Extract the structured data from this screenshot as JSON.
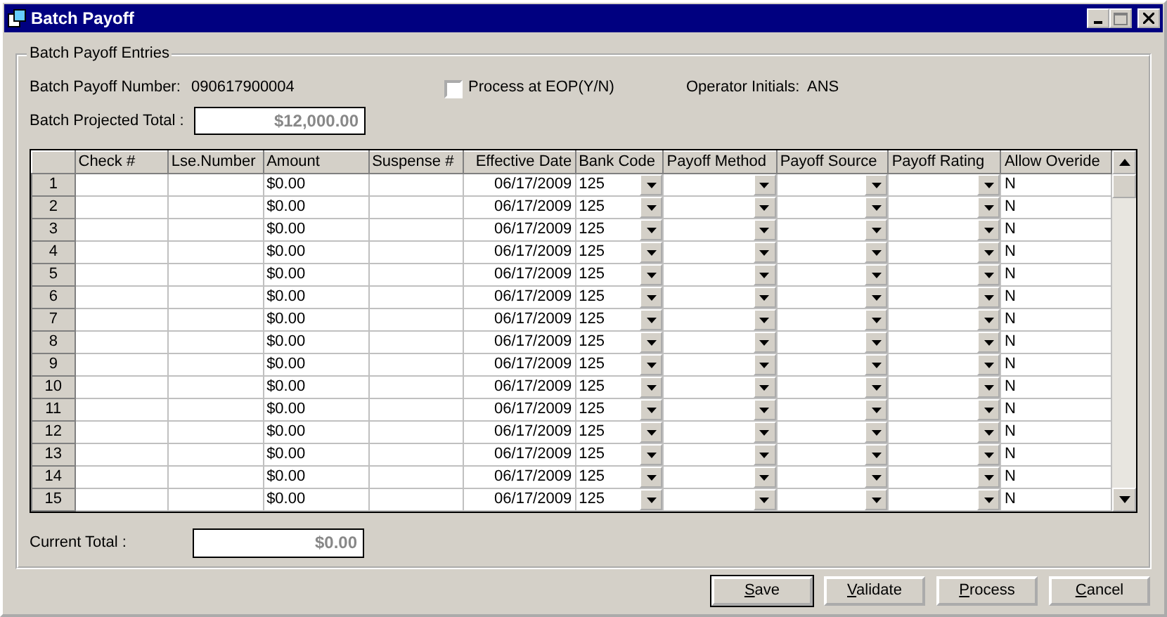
{
  "window": {
    "title": "Batch Payoff"
  },
  "group": {
    "title": "Batch Payoff Entries"
  },
  "batch_number": {
    "label": "Batch Payoff Number:",
    "value": "090617900004"
  },
  "process_eop": {
    "label": "Process at EOP(Y/N)",
    "checked": false
  },
  "operator": {
    "label": "Operator Initials:",
    "value": "ANS"
  },
  "projected_total": {
    "label": "Batch Projected Total :",
    "value": "$12,000.00"
  },
  "table": {
    "columns": [
      {
        "label": "Check #",
        "kind": "text"
      },
      {
        "label": "Lse.Number",
        "kind": "text"
      },
      {
        "label": "Amount",
        "kind": "text"
      },
      {
        "label": "Suspense #",
        "kind": "text"
      },
      {
        "label": "Effective Date",
        "kind": "date"
      },
      {
        "label": "Bank Code",
        "kind": "combo"
      },
      {
        "label": "Payoff Method",
        "kind": "combo"
      },
      {
        "label": "Payoff Source",
        "kind": "combo"
      },
      {
        "label": "Payoff Rating",
        "kind": "combo"
      },
      {
        "label": "Allow Overide",
        "kind": "text"
      }
    ],
    "rows": [
      {
        "number": "1",
        "cells": [
          "",
          "",
          "$0.00",
          "",
          "06/17/2009",
          "125",
          "",
          "",
          "",
          "N"
        ]
      },
      {
        "number": "2",
        "cells": [
          "",
          "",
          "$0.00",
          "",
          "06/17/2009",
          "125",
          "",
          "",
          "",
          "N"
        ]
      },
      {
        "number": "3",
        "cells": [
          "",
          "",
          "$0.00",
          "",
          "06/17/2009",
          "125",
          "",
          "",
          "",
          "N"
        ]
      },
      {
        "number": "4",
        "cells": [
          "",
          "",
          "$0.00",
          "",
          "06/17/2009",
          "125",
          "",
          "",
          "",
          "N"
        ]
      },
      {
        "number": "5",
        "cells": [
          "",
          "",
          "$0.00",
          "",
          "06/17/2009",
          "125",
          "",
          "",
          "",
          "N"
        ]
      },
      {
        "number": "6",
        "cells": [
          "",
          "",
          "$0.00",
          "",
          "06/17/2009",
          "125",
          "",
          "",
          "",
          "N"
        ]
      },
      {
        "number": "7",
        "cells": [
          "",
          "",
          "$0.00",
          "",
          "06/17/2009",
          "125",
          "",
          "",
          "",
          "N"
        ]
      },
      {
        "number": "8",
        "cells": [
          "",
          "",
          "$0.00",
          "",
          "06/17/2009",
          "125",
          "",
          "",
          "",
          "N"
        ]
      },
      {
        "number": "9",
        "cells": [
          "",
          "",
          "$0.00",
          "",
          "06/17/2009",
          "125",
          "",
          "",
          "",
          "N"
        ]
      },
      {
        "number": "10",
        "cells": [
          "",
          "",
          "$0.00",
          "",
          "06/17/2009",
          "125",
          "",
          "",
          "",
          "N"
        ]
      },
      {
        "number": "11",
        "cells": [
          "",
          "",
          "$0.00",
          "",
          "06/17/2009",
          "125",
          "",
          "",
          "",
          "N"
        ]
      },
      {
        "number": "12",
        "cells": [
          "",
          "",
          "$0.00",
          "",
          "06/17/2009",
          "125",
          "",
          "",
          "",
          "N"
        ]
      },
      {
        "number": "13",
        "cells": [
          "",
          "",
          "$0.00",
          "",
          "06/17/2009",
          "125",
          "",
          "",
          "",
          "N"
        ]
      },
      {
        "number": "14",
        "cells": [
          "",
          "",
          "$0.00",
          "",
          "06/17/2009",
          "125",
          "",
          "",
          "",
          "N"
        ]
      },
      {
        "number": "15",
        "cells": [
          "",
          "",
          "$0.00",
          "",
          "06/17/2009",
          "125",
          "",
          "",
          "",
          "N"
        ]
      }
    ]
  },
  "current_total": {
    "label": "Current Total :",
    "value": "$0.00"
  },
  "buttons": [
    {
      "label": "Save",
      "default": true
    },
    {
      "label": "Validate",
      "default": false
    },
    {
      "label": "Process",
      "default": false
    },
    {
      "label": "Cancel",
      "default": false
    }
  ]
}
